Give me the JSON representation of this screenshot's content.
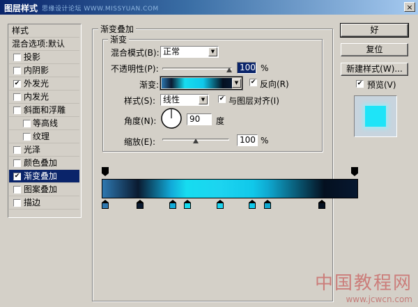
{
  "window": {
    "title": "图层样式",
    "watermark": "思缘设计论坛 WWW.MISSYUAN.COM",
    "close_glyph": "×"
  },
  "sidebar": {
    "header": "样式",
    "blend_defaults": "混合选项:默认",
    "items": [
      {
        "label": "投影",
        "checked": false,
        "indent": false,
        "selected": false
      },
      {
        "label": "内阴影",
        "checked": false,
        "indent": false,
        "selected": false
      },
      {
        "label": "外发光",
        "checked": true,
        "indent": false,
        "selected": false
      },
      {
        "label": "内发光",
        "checked": false,
        "indent": false,
        "selected": false
      },
      {
        "label": "斜面和浮雕",
        "checked": false,
        "indent": false,
        "selected": false
      },
      {
        "label": "等高线",
        "checked": false,
        "indent": true,
        "selected": false
      },
      {
        "label": "纹理",
        "checked": false,
        "indent": true,
        "selected": false
      },
      {
        "label": "光泽",
        "checked": false,
        "indent": false,
        "selected": false
      },
      {
        "label": "颜色叠加",
        "checked": false,
        "indent": false,
        "selected": false
      },
      {
        "label": "渐变叠加",
        "checked": true,
        "indent": false,
        "selected": true
      },
      {
        "label": "图案叠加",
        "checked": false,
        "indent": false,
        "selected": false
      },
      {
        "label": "描边",
        "checked": false,
        "indent": false,
        "selected": false
      }
    ]
  },
  "overlay": {
    "section_title": "渐变叠加",
    "group_title": "渐变",
    "blend_mode_label": "混合模式(B):",
    "blend_mode_value": "正常",
    "opacity_label": "不透明性(P):",
    "opacity_value": "100",
    "opacity_pct": 1.0,
    "percent": "%",
    "gradient_label": "渐变:",
    "reverse_label": "反向(R)",
    "reverse_checked": true,
    "style_label": "样式(S):",
    "style_value": "线性",
    "align_label": "与图层对齐(I)",
    "align_checked": true,
    "angle_label": "角度(N):",
    "angle_value": "90",
    "angle_unit": "度",
    "scale_label": "缩放(E):",
    "scale_value": "100",
    "scale_pct": 0.5,
    "check_glyph": "✔",
    "arrow_glyph": "▼"
  },
  "buttons": {
    "ok": "好",
    "reset": "复位",
    "new_style": "新建样式(W)...",
    "preview_label": "预览(V)",
    "preview_checked": true
  },
  "colors": {
    "preview_fill": "#1ee4f8",
    "selection": "#0a246a"
  },
  "gradient_editor": {
    "color_stops": [
      {
        "position": 0.0,
        "color": "#2e78b0"
      },
      {
        "position": 0.14,
        "color": "#0a1a30"
      },
      {
        "position": 0.27,
        "color": "#12aad8"
      },
      {
        "position": 0.33,
        "color": "#16dcf0"
      },
      {
        "position": 0.46,
        "color": "#1cd4f0"
      },
      {
        "position": 0.59,
        "color": "#10c8ea"
      },
      {
        "position": 0.65,
        "color": "#0fa8d0"
      },
      {
        "position": 0.87,
        "color": "#041020"
      }
    ],
    "opacity_stops": [
      0.0,
      1.0
    ]
  },
  "logo": {
    "name": "中国教程网",
    "url": "www.jcwcn.com"
  }
}
